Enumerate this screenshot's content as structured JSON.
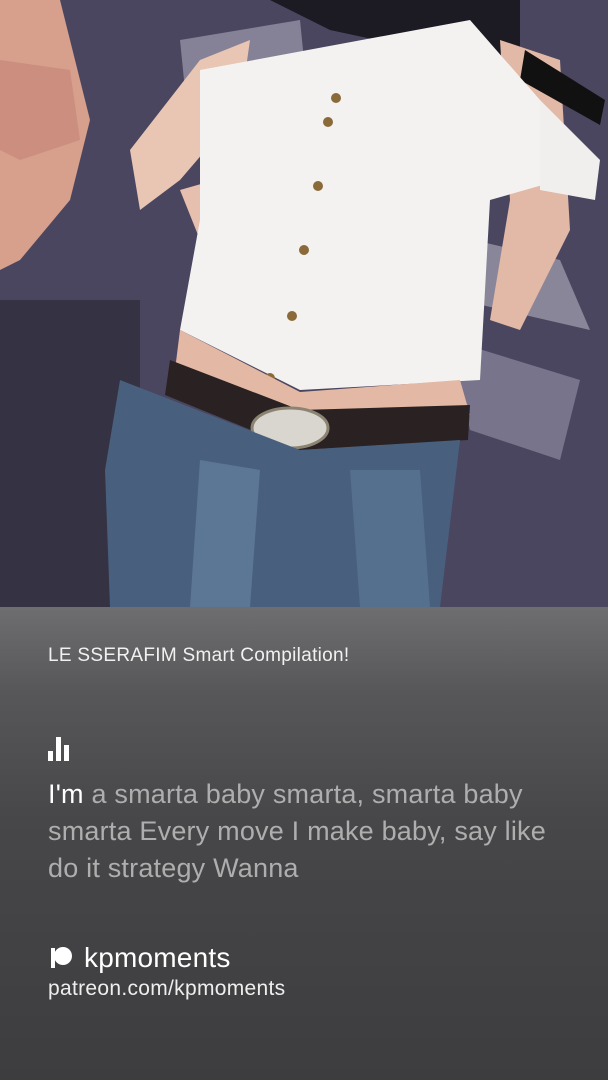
{
  "video": {
    "description_icon": "performance-video-frame"
  },
  "panel": {
    "caption": "LE SSERAFIM Smart Compilation!",
    "lyrics": {
      "highlighted": "I'm",
      "rest": " a smarta baby smarta, smarta baby smarta Every move I make baby, say like do it strategy Wanna"
    },
    "brand": {
      "icon": "patreon-icon",
      "name": "kpmoments",
      "url": "patreon.com/kpmoments"
    }
  },
  "colors": {
    "panel_top": "#6e6e70",
    "panel_bottom": "#3d3d3f",
    "lyrics_dim": "#aeaeae",
    "lyrics_active": "#ffffff"
  }
}
